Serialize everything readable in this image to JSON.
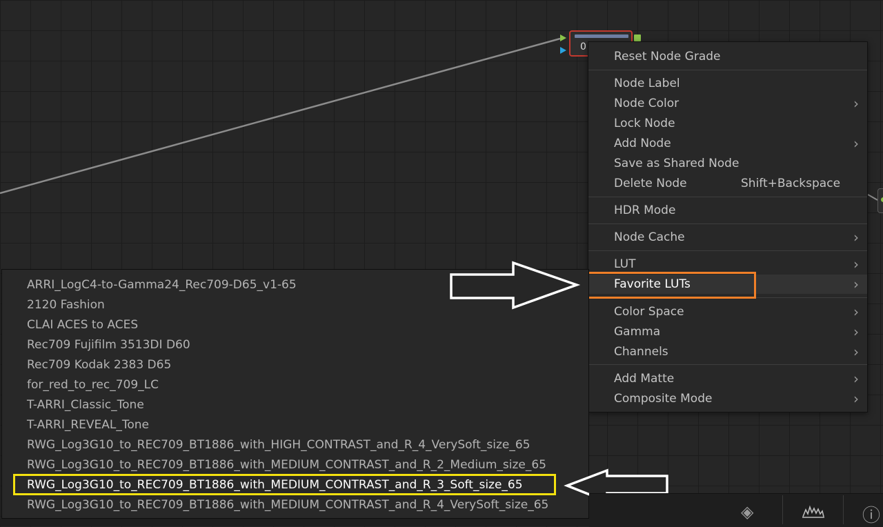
{
  "node": {
    "number": "0"
  },
  "context_menu": {
    "items": [
      {
        "label": "Reset Node Grade",
        "submenu": false
      },
      {
        "label": "Node Label",
        "submenu": false
      },
      {
        "label": "Node Color",
        "submenu": true
      },
      {
        "label": "Lock Node",
        "submenu": false
      },
      {
        "label": "Add Node",
        "submenu": true
      },
      {
        "label": "Save as Shared Node",
        "submenu": false
      },
      {
        "label": "Delete Node",
        "shortcut": "Shift+Backspace",
        "submenu": false
      },
      {
        "label": "HDR Mode",
        "submenu": false
      },
      {
        "label": "Node Cache",
        "submenu": true
      },
      {
        "label": "LUT",
        "submenu": true
      },
      {
        "label": "Favorite LUTs",
        "submenu": true,
        "active": true
      },
      {
        "label": "Color Space",
        "submenu": true
      },
      {
        "label": "Gamma",
        "submenu": true
      },
      {
        "label": "Channels",
        "submenu": true
      },
      {
        "label": "Add Matte",
        "submenu": true
      },
      {
        "label": "Composite Mode",
        "submenu": true
      }
    ],
    "chevron": "›"
  },
  "favorite_luts": {
    "items": [
      "ARRI_LogC4-to-Gamma24_Rec709-D65_v1-65",
      "2120 Fashion",
      "CLAI ACES to ACES",
      "Rec709 Fujifilm 3513DI D60",
      "Rec709 Kodak 2383 D65",
      "for_red_to_rec_709_LC",
      "T-ARRI_Classic_Tone",
      "T-ARRI_REVEAL_Tone",
      "RWG_Log3G10_to_REC709_BT1886_with_HIGH_CONTRAST_and_R_4_VerySoft_size_65",
      "RWG_Log3G10_to_REC709_BT1886_with_MEDIUM_CONTRAST_and_R_2_Medium_size_65",
      "RWG_Log3G10_to_REC709_BT1886_with_MEDIUM_CONTRAST_and_R_3_Soft_size_65",
      "RWG_Log3G10_to_REC709_BT1886_with_MEDIUM_CONTRAST_and_R_4_VerySoft_size_65"
    ],
    "selected_index": 10
  },
  "annotations": {
    "highlight_menu_color": "#f07f28",
    "highlight_lut_color": "#f4e10f"
  },
  "toolbar": {
    "icons": [
      "keyframes-icon",
      "scope-icon",
      "info-icon"
    ],
    "keyframes_glyph": "◈",
    "info_glyph": "ⓘ"
  }
}
